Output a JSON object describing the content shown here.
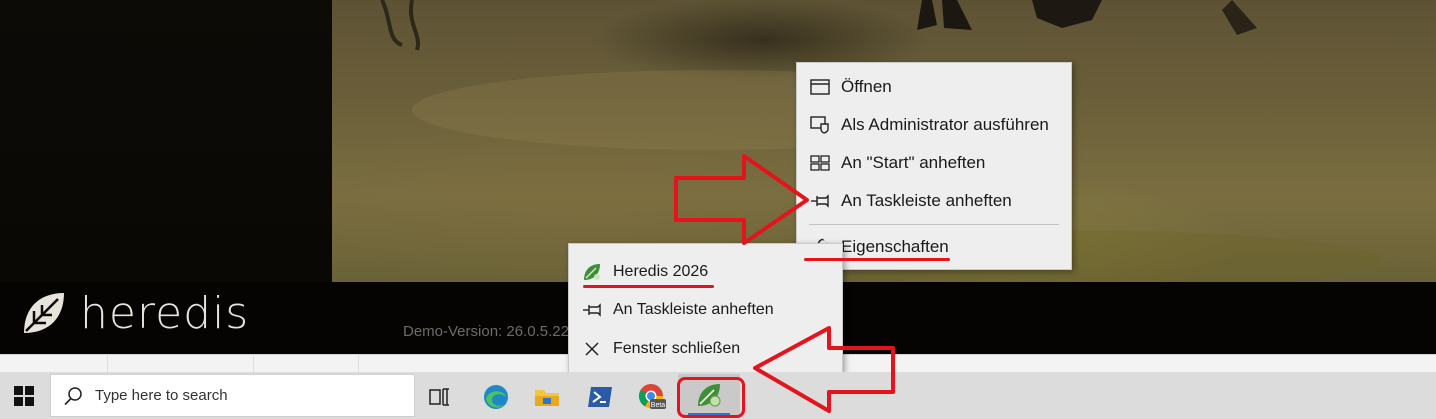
{
  "app": {
    "logo_text": "heredis",
    "demo_version": "Demo-Version: 26.0.5.22"
  },
  "context_menu_start": {
    "items": [
      {
        "label": "Öffnen",
        "icon": "window-icon"
      },
      {
        "label": "Als Administrator ausführen",
        "icon": "admin-shield-icon"
      },
      {
        "label": "An \"Start\" anheften",
        "icon": "start-tiles-icon"
      },
      {
        "label": "An Taskleiste anheften",
        "icon": "pin-icon"
      },
      {
        "label": "Eigenschaften",
        "icon": "wrench-icon"
      }
    ]
  },
  "jump_list": {
    "items": [
      {
        "label": "Heredis 2026",
        "icon": "heredis-app-icon"
      },
      {
        "label": "An Taskleiste anheften",
        "icon": "pin-icon"
      },
      {
        "label": "Fenster schließen",
        "icon": "close-icon"
      }
    ]
  },
  "taskbar": {
    "search_placeholder": "Type here to search",
    "icons": [
      "windows-start-icon",
      "task-view-icon",
      "edge-icon",
      "file-explorer-icon",
      "powershell-icon",
      "chrome-beta-icon",
      "heredis-icon"
    ],
    "chrome_badge": "Beta"
  },
  "colors": {
    "menu_bg": "#eeeeee",
    "annotation_red": "#e3141c",
    "taskbar_bg": "#dcdcdc",
    "app_bg": "#050403"
  }
}
